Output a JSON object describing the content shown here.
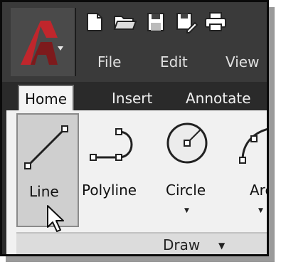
{
  "window": {
    "app_icon": "autocad-logo-icon",
    "quick_access": [
      "new-file-icon",
      "open-folder-icon",
      "save-icon",
      "save-as-icon",
      "print-icon"
    ]
  },
  "menu": {
    "items": [
      {
        "label": "File"
      },
      {
        "label": "Edit"
      },
      {
        "label": "View"
      }
    ]
  },
  "tabs": [
    {
      "label": "Home",
      "active": true
    },
    {
      "label": "Insert",
      "active": false
    },
    {
      "label": "Annotate",
      "active": false
    }
  ],
  "panel": {
    "title": "Draw",
    "tools": [
      {
        "label": "Line",
        "icon": "line-icon",
        "selected": true,
        "has_dropdown": false
      },
      {
        "label": "Polyline",
        "icon": "polyline-icon",
        "selected": false,
        "has_dropdown": false
      },
      {
        "label": "Circle",
        "icon": "circle-icon",
        "selected": false,
        "has_dropdown": true
      },
      {
        "label": "Arc",
        "icon": "arc-icon",
        "selected": false,
        "has_dropdown": true
      }
    ]
  },
  "colors": {
    "ribbon_dark": "#2b2b2b",
    "title_bar": "#3a3a3a",
    "panel_bg": "#f1f1f1",
    "selected_tool": "#cfcfcf",
    "logo_red": "#c0262c"
  }
}
